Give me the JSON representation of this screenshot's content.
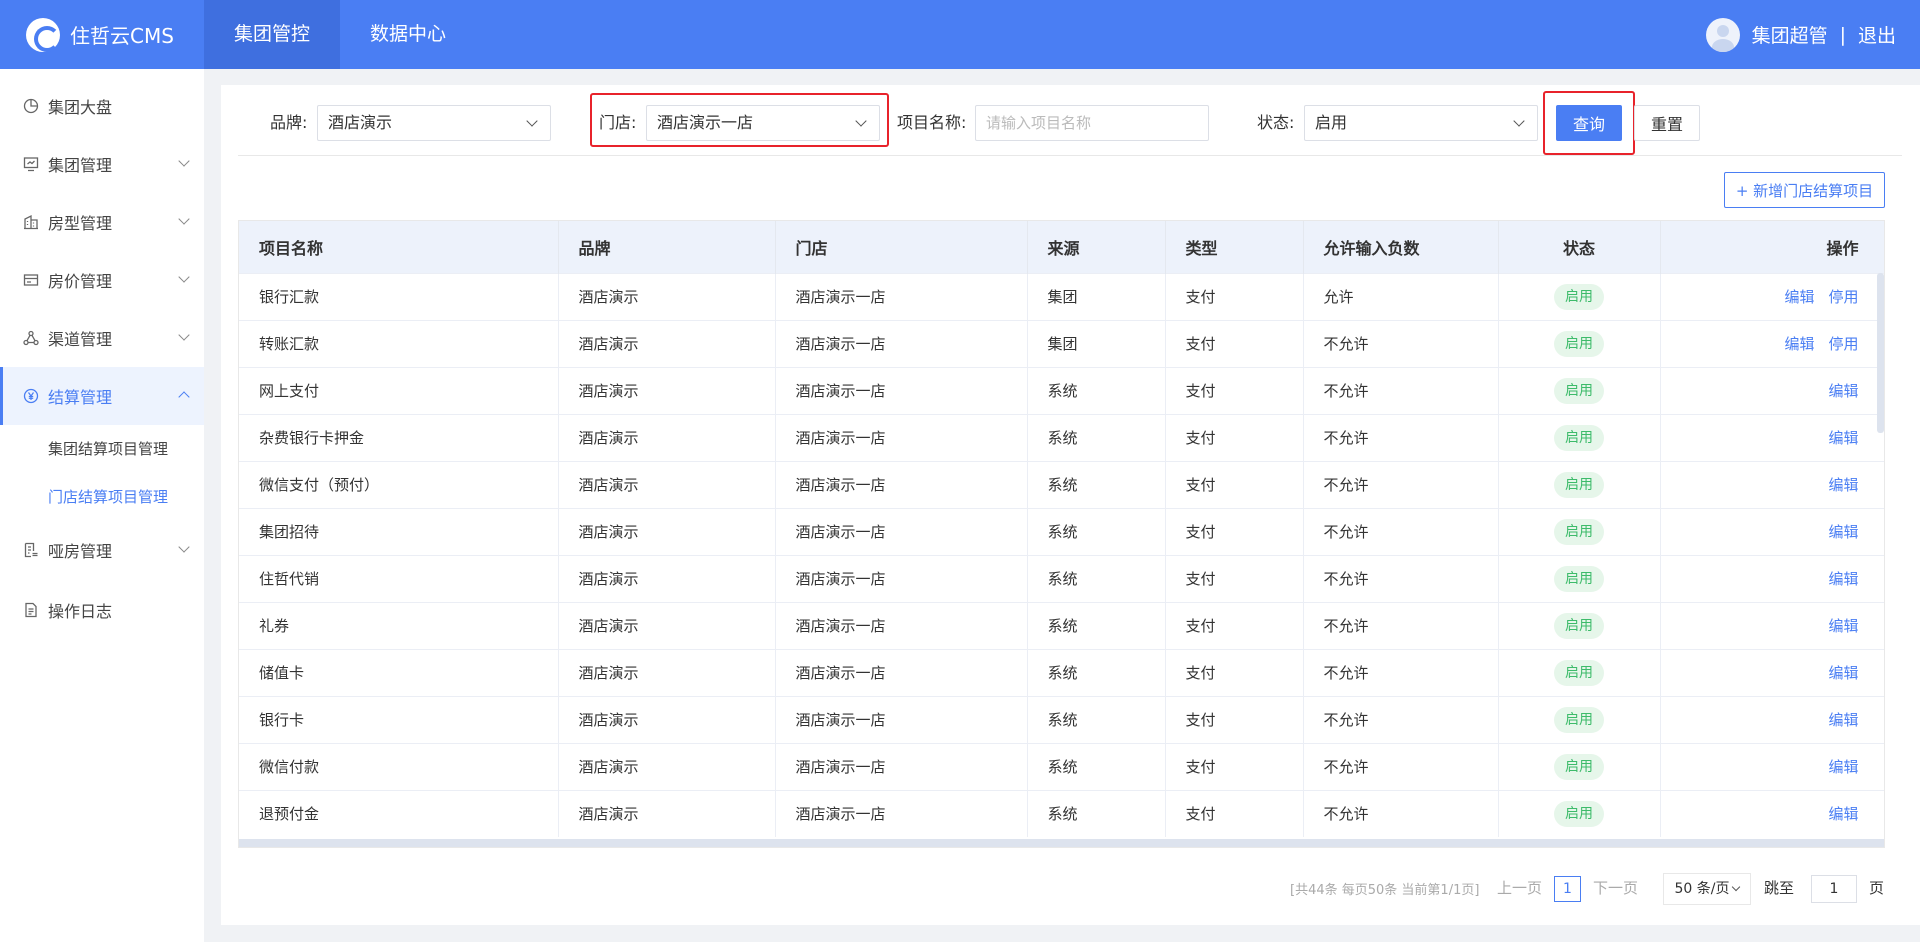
{
  "header": {
    "logo_text": "住哲云CMS",
    "nav": [
      {
        "label": "集团管控",
        "active": true
      },
      {
        "label": "数据中心",
        "active": false
      }
    ],
    "user_name": "集团超管",
    "separator": "|",
    "logout": "退出",
    "accent_color": "#4a7ef3"
  },
  "sidebar": {
    "items": [
      {
        "label": "集团大盘",
        "icon": "pie-chart-icon",
        "has_chevron": false
      },
      {
        "label": "集团管理",
        "icon": "monitor-icon",
        "has_chevron": true
      },
      {
        "label": "房型管理",
        "icon": "building-icon",
        "has_chevron": true
      },
      {
        "label": "房价管理",
        "icon": "price-card-icon",
        "has_chevron": true
      },
      {
        "label": "渠道管理",
        "icon": "network-icon",
        "has_chevron": true
      },
      {
        "label": "结算管理",
        "icon": "yen-icon",
        "has_chevron": true,
        "expanded": true,
        "active": true
      },
      {
        "label": "哑房管理",
        "icon": "document-list-icon",
        "has_chevron": true
      },
      {
        "label": "操作日志",
        "icon": "log-file-icon",
        "has_chevron": false
      }
    ],
    "sub_items": [
      {
        "label": "集团结算项目管理",
        "active": false
      },
      {
        "label": "门店结算项目管理",
        "active": true
      }
    ]
  },
  "filter": {
    "brand_label": "品牌:",
    "brand_value": "酒店演示",
    "store_label": "门店:",
    "store_value": "酒店演示一店",
    "name_label": "项目名称:",
    "name_placeholder": "请输入项目名称",
    "status_label": "状态:",
    "status_value": "启用",
    "query_button": "查询",
    "reset_button": "重置",
    "add_button": "+ 新增门店结算项目"
  },
  "table": {
    "columns": [
      "项目名称",
      "品牌",
      "门店",
      "来源",
      "类型",
      "允许输入负数",
      "状态",
      "操作"
    ],
    "rows": [
      {
        "name": "银行汇款",
        "brand": "酒店演示",
        "store": "酒店演示一店",
        "source": "集团",
        "type": "支付",
        "negative": "允许",
        "status": "启用",
        "actions": [
          "编辑",
          "停用"
        ]
      },
      {
        "name": "转账汇款",
        "brand": "酒店演示",
        "store": "酒店演示一店",
        "source": "集团",
        "type": "支付",
        "negative": "不允许",
        "status": "启用",
        "actions": [
          "编辑",
          "停用"
        ]
      },
      {
        "name": "网上支付",
        "brand": "酒店演示",
        "store": "酒店演示一店",
        "source": "系统",
        "type": "支付",
        "negative": "不允许",
        "status": "启用",
        "actions": [
          "编辑"
        ]
      },
      {
        "name": "杂费银行卡押金",
        "brand": "酒店演示",
        "store": "酒店演示一店",
        "source": "系统",
        "type": "支付",
        "negative": "不允许",
        "status": "启用",
        "actions": [
          "编辑"
        ]
      },
      {
        "name": "微信支付（预付）",
        "brand": "酒店演示",
        "store": "酒店演示一店",
        "source": "系统",
        "type": "支付",
        "negative": "不允许",
        "status": "启用",
        "actions": [
          "编辑"
        ]
      },
      {
        "name": "集团招待",
        "brand": "酒店演示",
        "store": "酒店演示一店",
        "source": "系统",
        "type": "支付",
        "negative": "不允许",
        "status": "启用",
        "actions": [
          "编辑"
        ]
      },
      {
        "name": "住哲代销",
        "brand": "酒店演示",
        "store": "酒店演示一店",
        "source": "系统",
        "type": "支付",
        "negative": "不允许",
        "status": "启用",
        "actions": [
          "编辑"
        ]
      },
      {
        "name": "礼券",
        "brand": "酒店演示",
        "store": "酒店演示一店",
        "source": "系统",
        "type": "支付",
        "negative": "不允许",
        "status": "启用",
        "actions": [
          "编辑"
        ]
      },
      {
        "name": "储值卡",
        "brand": "酒店演示",
        "store": "酒店演示一店",
        "source": "系统",
        "type": "支付",
        "negative": "不允许",
        "status": "启用",
        "actions": [
          "编辑"
        ]
      },
      {
        "name": "银行卡",
        "brand": "酒店演示",
        "store": "酒店演示一店",
        "source": "系统",
        "type": "支付",
        "negative": "不允许",
        "status": "启用",
        "actions": [
          "编辑"
        ]
      },
      {
        "name": "微信付款",
        "brand": "酒店演示",
        "store": "酒店演示一店",
        "source": "系统",
        "type": "支付",
        "negative": "不允许",
        "status": "启用",
        "actions": [
          "编辑"
        ]
      },
      {
        "name": "退预付金",
        "brand": "酒店演示",
        "store": "酒店演示一店",
        "source": "系统",
        "type": "支付",
        "negative": "不允许",
        "status": "启用",
        "actions": [
          "编辑"
        ]
      }
    ]
  },
  "pagination": {
    "summary": "[共44条 每页50条 当前第1/1页]",
    "prev": "上一页",
    "current_page": "1",
    "next": "下一页",
    "page_size": "50 条/页",
    "jump_label": "跳至",
    "jump_value": "1",
    "page_unit": "页"
  }
}
